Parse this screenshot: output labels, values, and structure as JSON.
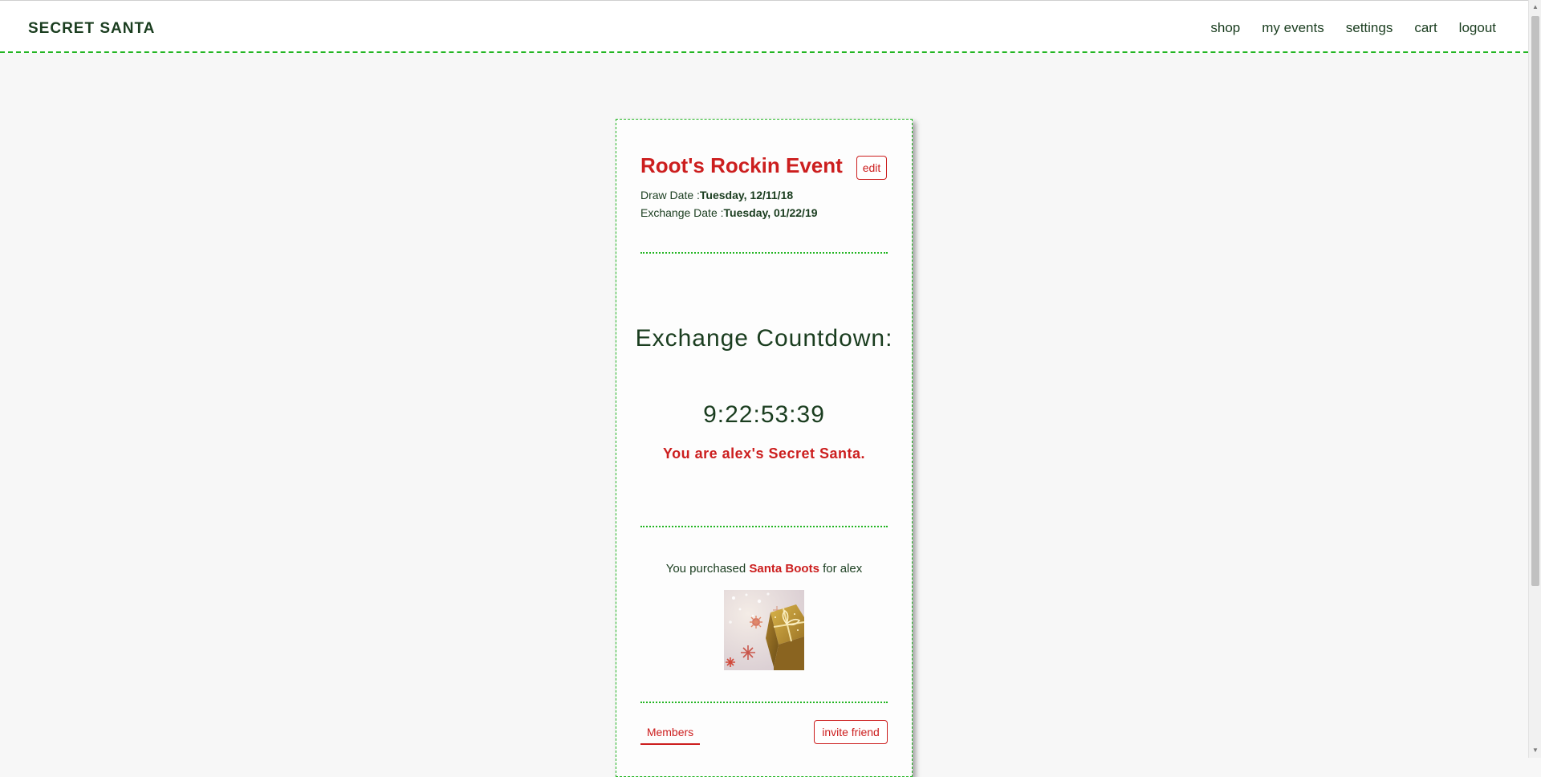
{
  "header": {
    "brand": "SECRET SANTA",
    "nav": [
      "shop",
      "my events",
      "settings",
      "cart",
      "logout"
    ]
  },
  "event": {
    "title": "Root's Rockin Event",
    "edit_label": "edit",
    "draw_date_label": "Draw Date :",
    "draw_date_value": "Tuesday, 12/11/18",
    "exchange_date_label": "Exchange Date :",
    "exchange_date_value": "Tuesday, 01/22/19"
  },
  "countdown": {
    "title": "Exchange Countdown:",
    "value": "9:22:53:39",
    "santa_message": "You are alex's Secret Santa."
  },
  "purchase": {
    "prefix": "You purchased ",
    "gift_name": "Santa Boots",
    "suffix": " for alex"
  },
  "footer_tabs": {
    "members_label": "Members",
    "invite_label": "invite friend"
  },
  "colors": {
    "brand_green": "#1a3d1f",
    "accent_red": "#cc1e1e",
    "dashed_green": "#22b522",
    "background": "#f7f7f7"
  }
}
